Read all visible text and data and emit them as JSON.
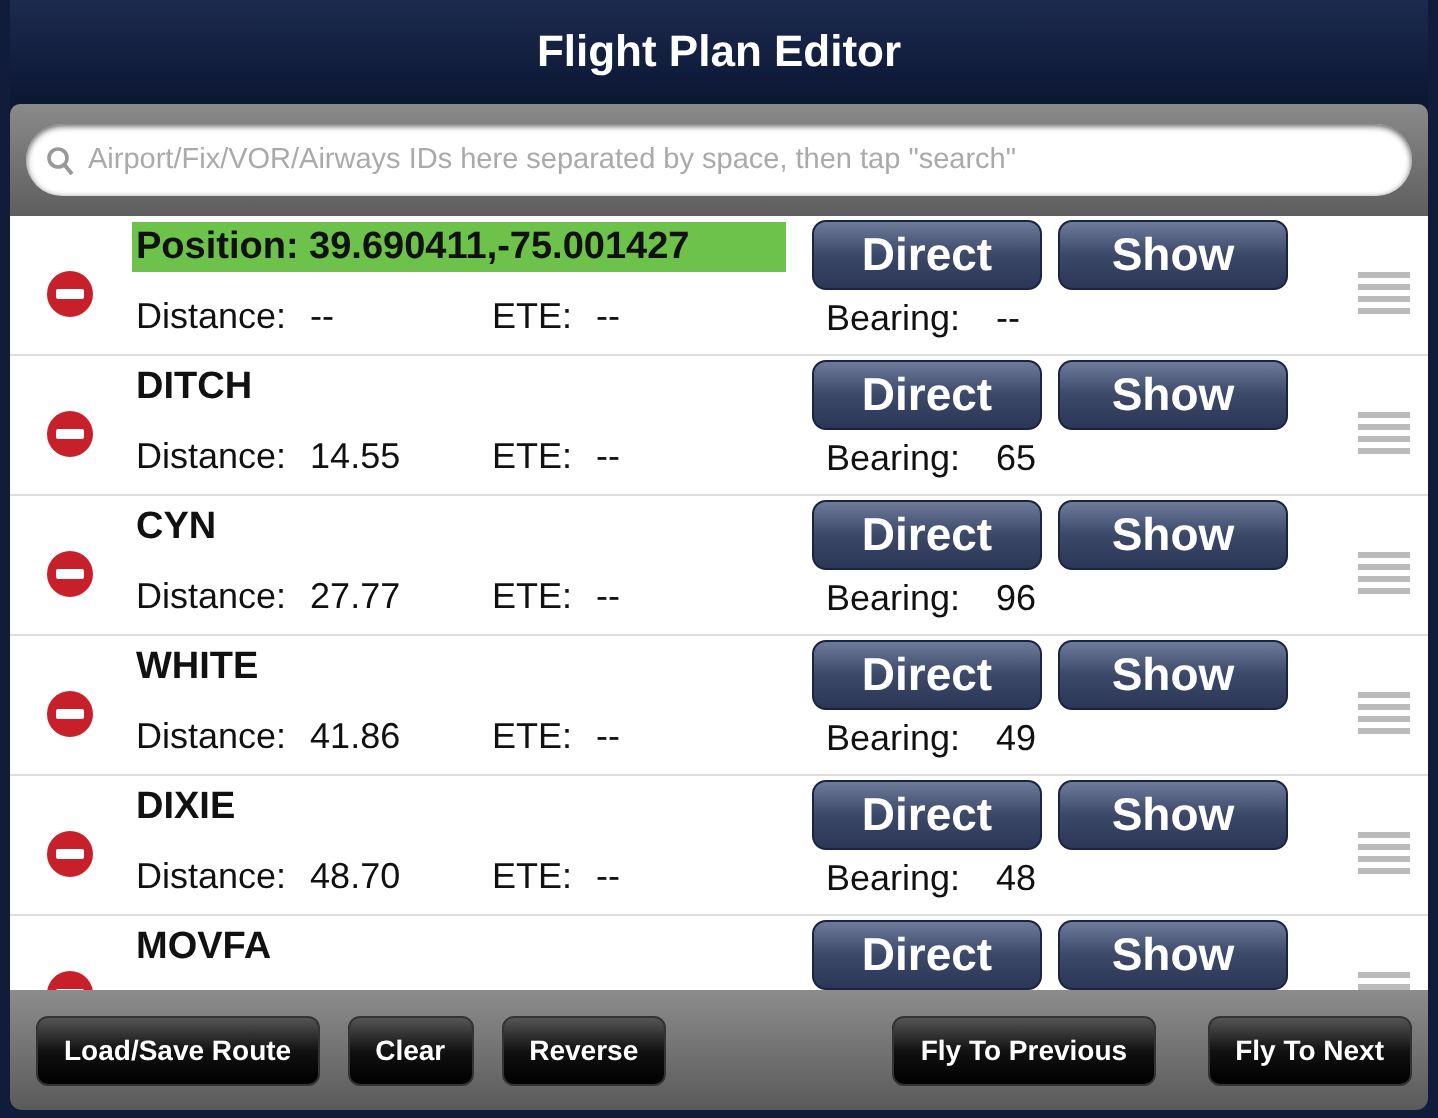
{
  "window": {
    "title": "Flight Plan Editor"
  },
  "search": {
    "placeholder": "Airport/Fix/VOR/Airways IDs here separated by space, then tap \"search\""
  },
  "waypoints": [
    {
      "name": "Position: 39.690411,-75.001427",
      "highlighted": true,
      "distance_label": "Distance:",
      "distance": "--",
      "ete_label": "ETE:",
      "ete": "--",
      "bearing_label": "Bearing:",
      "bearing": "--",
      "buttons": [
        "Direct",
        "Show"
      ]
    },
    {
      "name": "DITCH",
      "highlighted": false,
      "distance_label": "Distance:",
      "distance": "14.55",
      "ete_label": "ETE:",
      "ete": "--",
      "bearing_label": "Bearing:",
      "bearing": "65",
      "buttons": [
        "Direct",
        "Show"
      ]
    },
    {
      "name": "CYN",
      "highlighted": false,
      "distance_label": "Distance:",
      "distance": "27.77",
      "ete_label": "ETE:",
      "ete": "--",
      "bearing_label": "Bearing:",
      "bearing": "96",
      "buttons": [
        "Direct",
        "Show"
      ]
    },
    {
      "name": "WHITE",
      "highlighted": false,
      "distance_label": "Distance:",
      "distance": "41.86",
      "ete_label": "ETE:",
      "ete": "--",
      "bearing_label": "Bearing:",
      "bearing": "49",
      "buttons": [
        "Direct",
        "Show"
      ]
    },
    {
      "name": "DIXIE",
      "highlighted": false,
      "distance_label": "Distance:",
      "distance": "48.70",
      "ete_label": "ETE:",
      "ete": "--",
      "bearing_label": "Bearing:",
      "bearing": "48",
      "buttons": [
        "Direct",
        "Show"
      ]
    },
    {
      "name": "MOVFA",
      "highlighted": false,
      "buttons": [
        "Direct",
        "Show"
      ]
    }
  ],
  "toolbar": {
    "left": [
      "Load/Save Route",
      "Clear",
      "Reverse"
    ],
    "right": [
      "Fly To Previous",
      "Fly To Next"
    ]
  }
}
